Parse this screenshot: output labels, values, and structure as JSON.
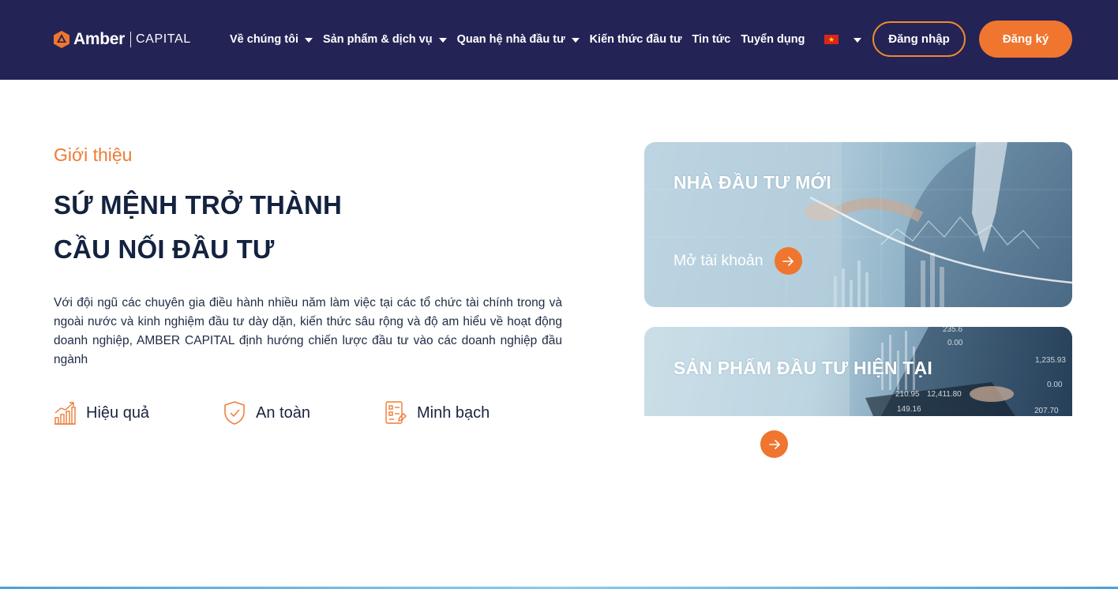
{
  "brand": {
    "name": "Amber",
    "suffix": "CAPITAL",
    "accent_color": "#f0752e",
    "header_color": "#232356"
  },
  "nav": {
    "items": [
      {
        "label": "Về chúng tôi",
        "has_dropdown": true
      },
      {
        "label": "Sản phẩm & dịch vụ",
        "has_dropdown": true
      },
      {
        "label": "Quan hệ nhà đầu tư",
        "has_dropdown": true
      },
      {
        "label": "Kiến thức đầu tư",
        "has_dropdown": false
      },
      {
        "label": "Tin tức",
        "has_dropdown": false
      },
      {
        "label": "Tuyển dụng",
        "has_dropdown": false
      }
    ],
    "language_flag": "vietnam-flag-icon",
    "login_label": "Đăng nhập",
    "register_label": "Đăng ký"
  },
  "intro": {
    "label": "Giới thiệu",
    "title_line1": "SỨ MỆNH TRỞ THÀNH",
    "title_line2": "CẦU NỐI ĐẦU TƯ",
    "description": "Với đội ngũ các chuyên gia điều hành nhiều năm làm việc tại các tổ chức tài chính trong và ngoài nước và kinh nghiệm đầu tư dày dặn, kiến thức sâu rộng và độ am hiểu về hoạt động doanh nghiệp, AMBER CAPITAL định hướng chiến lược đầu tư vào các doanh nghiệp đầu ngành",
    "features": [
      {
        "icon": "growth-chart-icon",
        "label": "Hiệu quả"
      },
      {
        "icon": "shield-check-icon",
        "label": "An toàn"
      },
      {
        "icon": "checklist-icon",
        "label": "Minh bạch"
      }
    ]
  },
  "cards": {
    "new_investor": {
      "title": "NHÀ ĐẦU TƯ MỚI",
      "link_label": "Mở tài khoản"
    },
    "current_products": {
      "title": "SẢN PHẨM ĐẦU TƯ HIỆN TẠI",
      "ticker_values": [
        "235.6",
        "0.00",
        "210.95",
        "12,411.80",
        "149.16",
        "1,235.93",
        "207.70",
        "0.00"
      ]
    }
  }
}
